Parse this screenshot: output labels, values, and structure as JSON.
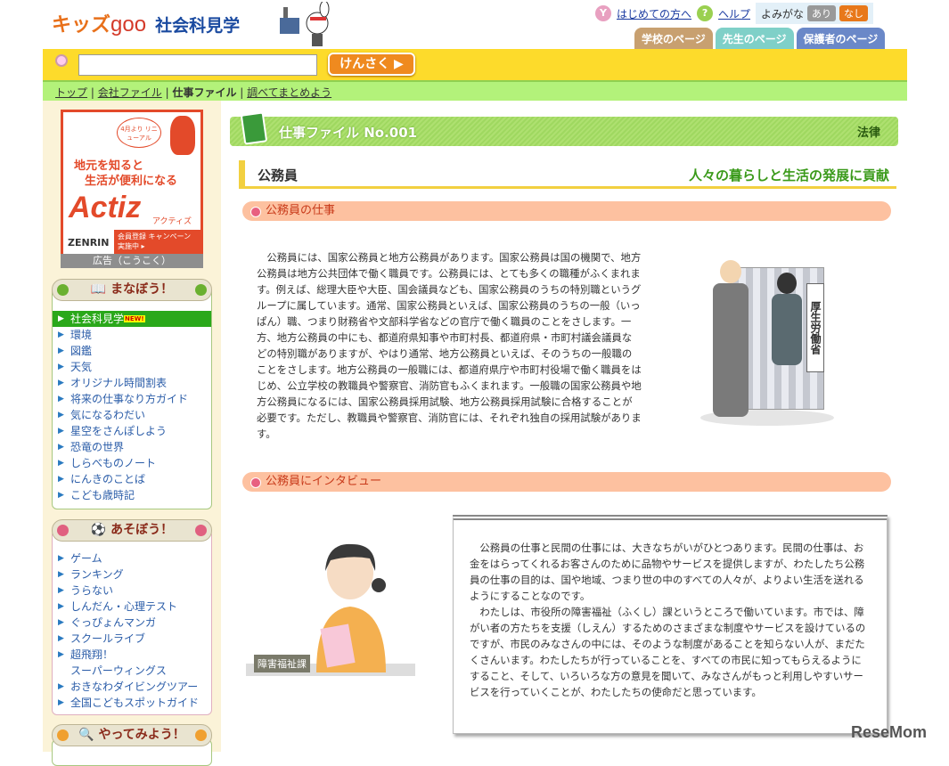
{
  "header": {
    "logo_main": "キッズ",
    "logo_goo": "goo",
    "logo_sub": "社会科見学",
    "first_time": "はじめての方へ",
    "help": "ヘルプ",
    "yomigana": "よみがな",
    "ari": "あり",
    "nashi": "なし",
    "tabs": [
      {
        "label": "学校のページ",
        "color": "#c8a070"
      },
      {
        "label": "先生のページ",
        "color": "#7fd0c8"
      },
      {
        "label": "保護者のページ",
        "color": "#6a88c8"
      }
    ]
  },
  "search": {
    "value": "",
    "button": "けんさく ▶"
  },
  "breadcrumb": {
    "top": "トップ",
    "company": "会社ファイル",
    "job": "仕事ファイル",
    "summary": "調べてまとめよう",
    "sep": "|"
  },
  "ad": {
    "bubble": "4月より リニューアル",
    "headline1": "地元を知ると",
    "headline2": "生活が便利になる",
    "brand": "Actiz",
    "brand_kana": "アクティズ",
    "maker": "ZENRIN",
    "campaign": "会員登録 キャンペーン実施中 ▸",
    "label": "広告（こうこく）"
  },
  "manabou": {
    "title": "まなぼう！",
    "new_badge": "NEW!",
    "items": [
      "社会科見学",
      "環境",
      "図鑑",
      "天気",
      "オリジナル時間割表",
      "将来の仕事なり方ガイド",
      "気になるわだい",
      "星空をさんぽしよう",
      "恐竜の世界",
      "しらべものノート",
      "にんきのことば",
      "こども歳時記"
    ]
  },
  "asobou": {
    "title": "あそぼう！",
    "items": [
      "ゲーム",
      "ランキング",
      "うらない",
      "しんだん・心理テスト",
      "ぐっぴょんマンガ",
      "スクールライブ",
      "超飛翔！",
      "スーパーウィングス",
      "おきなわダイビングツアー",
      "全国こどもスポットガイド"
    ]
  },
  "yattemiyou": {
    "title": "やってみよう！"
  },
  "main": {
    "file_title": "仕事ファイル  No.001",
    "category": "法律",
    "job_name": "公務員",
    "tagline": "人々の暮らしと生活の発展に貢献",
    "section1": "公務員の仕事",
    "section1_text": "公務員には、国家公務員と地方公務員があります。国家公務員は国の機関で、地方公務員は地方公共団体で働く職員です。公務員には、とても多くの職種がふくまれます。例えば、総理大臣や大臣、国会議員なども、国家公務員のうちの特別職というグループに属しています。通常、国家公務員といえば、国家公務員のうちの一般（いっぱん）職、つまり財務省や文部科学省などの官庁で働く職員のことをさします。一方、地方公務員の中にも、都道府県知事や市町村長、都道府県・市町村議会議員などの特別職がありますが、やはり通常、地方公務員といえば、そのうちの一般職のことをさします。地方公務員の一般職には、都道府県庁や市町村役場で働く職員をはじめ、公立学校の教職員や警察官、消防官もふくまれます。一般職の国家公務員や地方公務員になるには、国家公務員採用試験、地方公務員採用試験に合格することが必要です。ただし、教職員や警察官、消防官には、それぞれ独自の採用試験があります。",
    "building_sign": "厚生労働省",
    "section2": "公務員にインタビュー",
    "interview_label": "障害福祉課",
    "interview_p1": "公務員の仕事と民間の仕事には、大きなちがいがひとつあります。民間の仕事は、お金をはらってくれるお客さんのために品物やサービスを提供しますが、わたしたち公務員の仕事の目的は、国や地域、つまり世の中のすべての人々が、よりよい生活を送れるようにすることなのです。",
    "interview_p2": "わたしは、市役所の障害福祉（ふくし）課というところで働いています。市では、障がい者の方たちを支援（しえん）するためのさまざまな制度やサービスを設けているのですが、市民のみなさんの中には、そのような制度があることを知らない人が、まだたくさんいます。わたしたちが行っていることを、すべての市民に知ってもらえるようにすること、そして、いろいろな方の意見を聞いて、みなさんがもっと利用しやすいサービスを行っていくことが、わたしたちの使命だと思っています。"
  },
  "watermark": "ReseMom"
}
